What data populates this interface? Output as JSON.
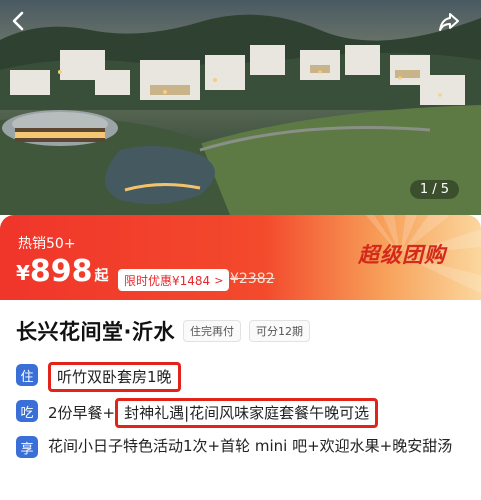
{
  "hero": {
    "image_counter": "1 / 5",
    "back_icon": "chevron-left-icon",
    "share_icon": "share-icon"
  },
  "promo": {
    "hot_label": "热销50+",
    "price_symbol": "¥",
    "price_value": "898",
    "price_unit": "起",
    "discount_label": "限时优惠¥1484",
    "discount_arrow": ">",
    "original_price": "¥2382",
    "group_buy_label": "超级团购",
    "colors": {
      "red": "#f0352b",
      "accent": "#e2231a",
      "group_buy_text": "#d42a1c"
    }
  },
  "product": {
    "title": "长兴花间堂·沂水",
    "tags": [
      "住完再付",
      "可分12期"
    ],
    "rows": [
      {
        "badge": "住",
        "segments": [
          {
            "text": "听竹双卧套房1晚",
            "highlighted": true
          }
        ]
      },
      {
        "badge": "吃",
        "segments": [
          {
            "text": "2份早餐+",
            "highlighted": false
          },
          {
            "text": "封神礼遇|花间风味家庭套餐午晚可选",
            "highlighted": true
          }
        ]
      },
      {
        "badge": "享",
        "segments": [
          {
            "text": "花间小日子特色活动1次+首轮 mini 吧+欢迎水果+晚安甜汤",
            "highlighted": false
          }
        ]
      }
    ],
    "badge_color": "#3a6fd8"
  }
}
